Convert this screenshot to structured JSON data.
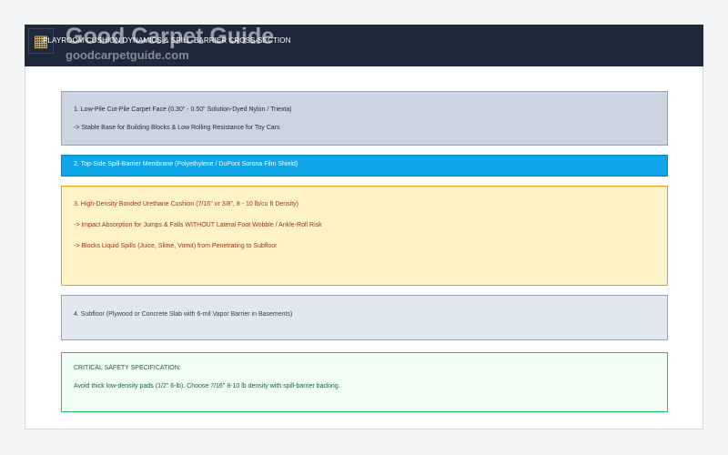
{
  "header": {
    "title": "PLAYROOM CUSHION DYNAMICS & SPILL-BARRIER CROSS-SECTION",
    "logo_icon": "carpet-grid-icon",
    "watermark_title": "Good Carpet Guide",
    "watermark_url": "goodcarpetguide.com"
  },
  "layers": [
    {
      "label": "1. Low-Pile Cut-Pile Carpet Face (0.30\" - 0.50\" Solution-Dyed Nylon / Triexta)",
      "note": "-> Stable Base for Building Blocks & Low Rolling Resistance for Toy Cars"
    },
    {
      "label": "2. Top-Side Spill-Barrier Membrane (Polyethylene / DuPont Sorona Film Shield)"
    },
    {
      "label": "3. High-Density Bonded Urethane Cushion (7/16\" or 3/8\", 8 - 10 lb/cu ft Density)",
      "notes": [
        "-> Impact Absorption for Jumps & Falls WITHOUT Lateral Foot Wobble / Ankle-Roll Risk",
        "-> Blocks Liquid Spills (Juice, Slime, Vomit) from Penetrating to Subfloor"
      ]
    },
    {
      "label": "4. Subfloor (Plywood or Concrete Slab with 6-mil Vapor Barrier in Basements)"
    }
  ],
  "spec": {
    "title": "CRITICAL SAFETY SPECIFICATION:",
    "text": "Avoid thick low-density pads (1/2\" 6-lb). Choose 7/16\" 8-10 lb density with spill-barrier backing."
  },
  "colors": {
    "header_bg": "#1e293b",
    "carpet_face": "#cbd5e1",
    "barrier": "#0ea5e9",
    "cushion": "#fef3c7",
    "cushion_border": "#f59e0b",
    "subfloor": "#e2e8f0",
    "spec_bg": "#f0fdf4",
    "spec_border": "#22c55e"
  }
}
